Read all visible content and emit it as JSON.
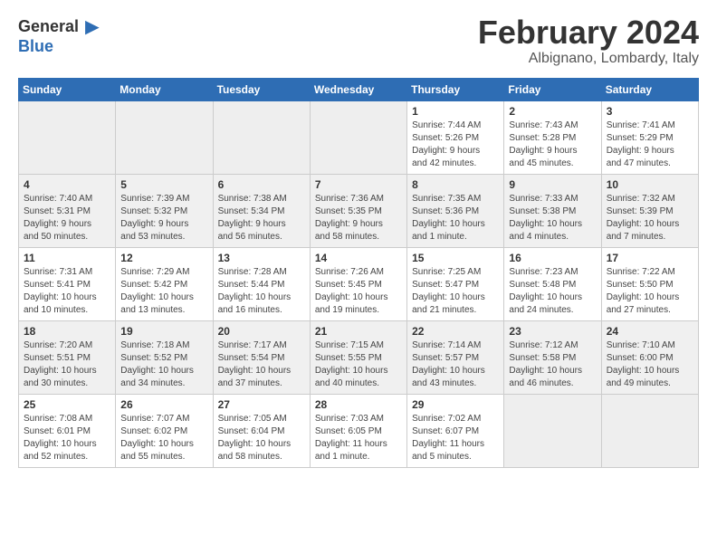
{
  "header": {
    "logo_general": "General",
    "logo_blue": "Blue",
    "month_title": "February 2024",
    "location": "Albignano, Lombardy, Italy"
  },
  "weekdays": [
    "Sunday",
    "Monday",
    "Tuesday",
    "Wednesday",
    "Thursday",
    "Friday",
    "Saturday"
  ],
  "rows": [
    {
      "row_class": "row-1",
      "cells": [
        {
          "empty": true
        },
        {
          "empty": true
        },
        {
          "empty": true
        },
        {
          "empty": true
        },
        {
          "day": "1",
          "info": "Sunrise: 7:44 AM\nSunset: 5:26 PM\nDaylight: 9 hours\nand 42 minutes."
        },
        {
          "day": "2",
          "info": "Sunrise: 7:43 AM\nSunset: 5:28 PM\nDaylight: 9 hours\nand 45 minutes."
        },
        {
          "day": "3",
          "info": "Sunrise: 7:41 AM\nSunset: 5:29 PM\nDaylight: 9 hours\nand 47 minutes."
        }
      ]
    },
    {
      "row_class": "row-2",
      "cells": [
        {
          "day": "4",
          "info": "Sunrise: 7:40 AM\nSunset: 5:31 PM\nDaylight: 9 hours\nand 50 minutes."
        },
        {
          "day": "5",
          "info": "Sunrise: 7:39 AM\nSunset: 5:32 PM\nDaylight: 9 hours\nand 53 minutes."
        },
        {
          "day": "6",
          "info": "Sunrise: 7:38 AM\nSunset: 5:34 PM\nDaylight: 9 hours\nand 56 minutes."
        },
        {
          "day": "7",
          "info": "Sunrise: 7:36 AM\nSunset: 5:35 PM\nDaylight: 9 hours\nand 58 minutes."
        },
        {
          "day": "8",
          "info": "Sunrise: 7:35 AM\nSunset: 5:36 PM\nDaylight: 10 hours\nand 1 minute."
        },
        {
          "day": "9",
          "info": "Sunrise: 7:33 AM\nSunset: 5:38 PM\nDaylight: 10 hours\nand 4 minutes."
        },
        {
          "day": "10",
          "info": "Sunrise: 7:32 AM\nSunset: 5:39 PM\nDaylight: 10 hours\nand 7 minutes."
        }
      ]
    },
    {
      "row_class": "row-3",
      "cells": [
        {
          "day": "11",
          "info": "Sunrise: 7:31 AM\nSunset: 5:41 PM\nDaylight: 10 hours\nand 10 minutes."
        },
        {
          "day": "12",
          "info": "Sunrise: 7:29 AM\nSunset: 5:42 PM\nDaylight: 10 hours\nand 13 minutes."
        },
        {
          "day": "13",
          "info": "Sunrise: 7:28 AM\nSunset: 5:44 PM\nDaylight: 10 hours\nand 16 minutes."
        },
        {
          "day": "14",
          "info": "Sunrise: 7:26 AM\nSunset: 5:45 PM\nDaylight: 10 hours\nand 19 minutes."
        },
        {
          "day": "15",
          "info": "Sunrise: 7:25 AM\nSunset: 5:47 PM\nDaylight: 10 hours\nand 21 minutes."
        },
        {
          "day": "16",
          "info": "Sunrise: 7:23 AM\nSunset: 5:48 PM\nDaylight: 10 hours\nand 24 minutes."
        },
        {
          "day": "17",
          "info": "Sunrise: 7:22 AM\nSunset: 5:50 PM\nDaylight: 10 hours\nand 27 minutes."
        }
      ]
    },
    {
      "row_class": "row-4",
      "cells": [
        {
          "day": "18",
          "info": "Sunrise: 7:20 AM\nSunset: 5:51 PM\nDaylight: 10 hours\nand 30 minutes."
        },
        {
          "day": "19",
          "info": "Sunrise: 7:18 AM\nSunset: 5:52 PM\nDaylight: 10 hours\nand 34 minutes."
        },
        {
          "day": "20",
          "info": "Sunrise: 7:17 AM\nSunset: 5:54 PM\nDaylight: 10 hours\nand 37 minutes."
        },
        {
          "day": "21",
          "info": "Sunrise: 7:15 AM\nSunset: 5:55 PM\nDaylight: 10 hours\nand 40 minutes."
        },
        {
          "day": "22",
          "info": "Sunrise: 7:14 AM\nSunset: 5:57 PM\nDaylight: 10 hours\nand 43 minutes."
        },
        {
          "day": "23",
          "info": "Sunrise: 7:12 AM\nSunset: 5:58 PM\nDaylight: 10 hours\nand 46 minutes."
        },
        {
          "day": "24",
          "info": "Sunrise: 7:10 AM\nSunset: 6:00 PM\nDaylight: 10 hours\nand 49 minutes."
        }
      ]
    },
    {
      "row_class": "row-5",
      "cells": [
        {
          "day": "25",
          "info": "Sunrise: 7:08 AM\nSunset: 6:01 PM\nDaylight: 10 hours\nand 52 minutes."
        },
        {
          "day": "26",
          "info": "Sunrise: 7:07 AM\nSunset: 6:02 PM\nDaylight: 10 hours\nand 55 minutes."
        },
        {
          "day": "27",
          "info": "Sunrise: 7:05 AM\nSunset: 6:04 PM\nDaylight: 10 hours\nand 58 minutes."
        },
        {
          "day": "28",
          "info": "Sunrise: 7:03 AM\nSunset: 6:05 PM\nDaylight: 11 hours\nand 1 minute."
        },
        {
          "day": "29",
          "info": "Sunrise: 7:02 AM\nSunset: 6:07 PM\nDaylight: 11 hours\nand 5 minutes."
        },
        {
          "empty": true
        },
        {
          "empty": true
        }
      ]
    }
  ]
}
